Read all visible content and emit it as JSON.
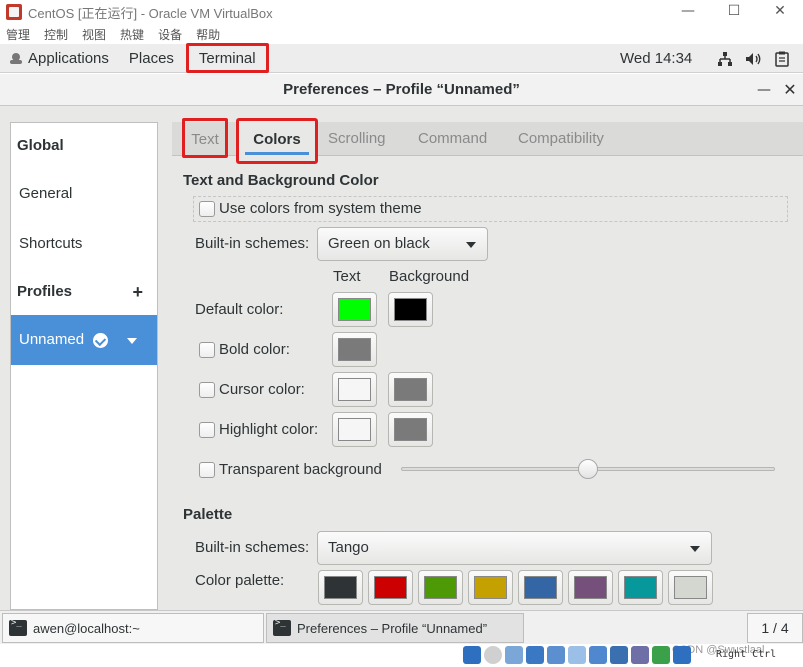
{
  "vbox": {
    "title": "CentOS [正在运行] - Oracle VM VirtualBox",
    "window_buttons": {
      "minimize": "—",
      "maximize": "☐",
      "close": "✕"
    },
    "menu": [
      "管理",
      "控制",
      "视图",
      "热键",
      "设备",
      "帮助"
    ],
    "status": {
      "host_key": "Right Ctrl",
      "watermark": "CSDN @Swustlaal"
    }
  },
  "gnome_topbar": {
    "applications": "Applications",
    "places": "Places",
    "terminal": "Terminal",
    "clock": "Wed 14:34",
    "tray_icons": [
      "network-icon",
      "volume-icon",
      "clipboard-icon"
    ]
  },
  "dialog": {
    "title": "Preferences – Profile “Unnamed”",
    "minimize": "—",
    "close": "✕"
  },
  "sidebar": {
    "global": "Global",
    "general": "General",
    "shortcuts": "Shortcuts",
    "profiles": "Profiles",
    "add": "+",
    "profile_selected": "Unnamed"
  },
  "tabs": [
    "Text",
    "Colors",
    "Scrolling",
    "Command",
    "Compatibility"
  ],
  "colors_tab": {
    "section_text_bg": "Text and Background Color",
    "use_system_theme": "Use colors from system theme",
    "builtin_schemes_label": "Built-in schemes:",
    "builtin_schemes_value": "Green on black",
    "col_text": "Text",
    "col_background": "Background",
    "default_color": "Default color:",
    "bold_color": "Bold color:",
    "cursor_color": "Cursor color:",
    "highlight_color": "Highlight color:",
    "transparent_bg": "Transparent background",
    "transparency_level": 0.5,
    "section_palette": "Palette",
    "palette_schemes_label": "Built-in schemes:",
    "palette_schemes_value": "Tango",
    "color_palette_label": "Color palette:",
    "swatches": {
      "default_text": "#00ff00",
      "default_background": "#000000",
      "bold": "#7a7a7a",
      "cursor_text": "#f6f6f6",
      "cursor_background": "#7a7a7a",
      "highlight_text": "#f6f6f6",
      "highlight_background": "#7a7a7a"
    },
    "palette": [
      "#2e3436",
      "#cc0000",
      "#4e9a06",
      "#c4a000",
      "#3465a4",
      "#75507b",
      "#06989a",
      "#d3d7cf"
    ]
  },
  "taskbar": {
    "terminal_task": "awen@localhost:~",
    "prefs_task": "Preferences – Profile “Unnamed”",
    "pager": "1 / 4"
  },
  "accent": "#4a90d9",
  "highlight_box": "#e02020"
}
